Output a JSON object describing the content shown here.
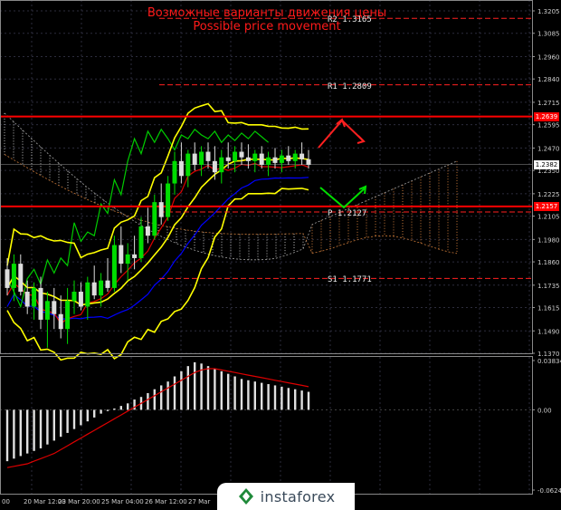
{
  "titles": {
    "ru": "Возможные варианты движения цены",
    "en": "Possible price movement"
  },
  "chart_data": {
    "type": "candlestick",
    "price_axis": {
      "min": 1.137,
      "max": 1.3205,
      "ticks": [
        "1.3205",
        "1.3085",
        "1.2960",
        "1.2840",
        "1.2715",
        "1.2595",
        "1.2470",
        "1.2350",
        "1.2225",
        "1.2105",
        "1.1980",
        "1.1860",
        "1.1735",
        "1.1615",
        "1.1490",
        "1.1370"
      ]
    },
    "oscillator_axis": {
      "min": -0.06247,
      "max": 0.03834,
      "ticks": [
        "0.03834",
        "0.00",
        "-0.06247"
      ]
    },
    "time_axis": [
      "00",
      "20 Mar 12:00",
      "23 Mar 20:00",
      "25 Mar 04:00",
      "26 Mar 12:00",
      "27 Mar"
    ],
    "levels": [
      {
        "name": "R2",
        "label": "R2  1.3165",
        "value": 1.3165,
        "style": "dashed",
        "color": "#ff2020"
      },
      {
        "name": "R1",
        "label": "R1  1.2809",
        "value": 1.2809,
        "style": "dashed",
        "color": "#ff2020"
      },
      {
        "name": "Resistance",
        "label": "1.2639",
        "value": 1.2639,
        "style": "solid",
        "color": "#ff0000"
      },
      {
        "name": "Pivot",
        "label": "P  1.2127",
        "value": 1.2127,
        "style": "dashed",
        "color": "#ff2020"
      },
      {
        "name": "Support",
        "label": "1.2157",
        "value": 1.2157,
        "style": "solid",
        "color": "#ff0000"
      },
      {
        "name": "S1",
        "label": "S1  1.1771",
        "value": 1.1771,
        "style": "dashed",
        "color": "#ff2020"
      }
    ],
    "current_price": "1.2382",
    "candles": [
      [
        1.182,
        1.188,
        1.168,
        1.172
      ],
      [
        1.172,
        1.19,
        1.165,
        1.185
      ],
      [
        1.185,
        1.19,
        1.168,
        1.17
      ],
      [
        1.17,
        1.176,
        1.158,
        1.162
      ],
      [
        1.162,
        1.175,
        1.155,
        1.172
      ],
      [
        1.172,
        1.178,
        1.15,
        1.155
      ],
      [
        1.155,
        1.17,
        1.14,
        1.165
      ],
      [
        1.165,
        1.172,
        1.15,
        1.158
      ],
      [
        1.158,
        1.168,
        1.145,
        1.15
      ],
      [
        1.15,
        1.172,
        1.142,
        1.165
      ],
      [
        1.165,
        1.176,
        1.158,
        1.17
      ],
      [
        1.17,
        1.175,
        1.16,
        1.162
      ],
      [
        1.162,
        1.178,
        1.155,
        1.175
      ],
      [
        1.175,
        1.184,
        1.166,
        1.168
      ],
      [
        1.168,
        1.18,
        1.162,
        1.176
      ],
      [
        1.176,
        1.188,
        1.17,
        1.172
      ],
      [
        1.172,
        1.2,
        1.17,
        1.195
      ],
      [
        1.195,
        1.205,
        1.18,
        1.185
      ],
      [
        1.185,
        1.196,
        1.176,
        1.19
      ],
      [
        1.19,
        1.2,
        1.182,
        1.188
      ],
      [
        1.188,
        1.21,
        1.186,
        1.205
      ],
      [
        1.205,
        1.215,
        1.196,
        1.2
      ],
      [
        1.2,
        1.222,
        1.198,
        1.218
      ],
      [
        1.218,
        1.228,
        1.206,
        1.21
      ],
      [
        1.21,
        1.232,
        1.208,
        1.228
      ],
      [
        1.228,
        1.245,
        1.222,
        1.24
      ],
      [
        1.24,
        1.25,
        1.228,
        1.232
      ],
      [
        1.232,
        1.246,
        1.226,
        1.244
      ],
      [
        1.244,
        1.25,
        1.235,
        1.238
      ],
      [
        1.238,
        1.248,
        1.232,
        1.245
      ],
      [
        1.245,
        1.25,
        1.236,
        1.24
      ],
      [
        1.24,
        1.248,
        1.23,
        1.234
      ],
      [
        1.234,
        1.246,
        1.228,
        1.242
      ],
      [
        1.242,
        1.25,
        1.236,
        1.24
      ],
      [
        1.24,
        1.248,
        1.234,
        1.245
      ],
      [
        1.245,
        1.25,
        1.238,
        1.242
      ],
      [
        1.242,
        1.249,
        1.236,
        1.24
      ],
      [
        1.24,
        1.246,
        1.234,
        1.244
      ],
      [
        1.244,
        1.248,
        1.236,
        1.238
      ],
      [
        1.238,
        1.245,
        1.232,
        1.242
      ],
      [
        1.242,
        1.247,
        1.236,
        1.239
      ],
      [
        1.239,
        1.246,
        1.234,
        1.243
      ],
      [
        1.243,
        1.248,
        1.238,
        1.24
      ],
      [
        1.24,
        1.246,
        1.236,
        1.244
      ],
      [
        1.244,
        1.25,
        1.238,
        1.241
      ],
      [
        1.241,
        1.246,
        1.236,
        1.238
      ]
    ],
    "histogram": [
      -0.04,
      -0.038,
      -0.036,
      -0.034,
      -0.032,
      -0.03,
      -0.027,
      -0.024,
      -0.021,
      -0.018,
      -0.015,
      -0.012,
      -0.009,
      -0.006,
      -0.003,
      -0.001,
      0.001,
      0.003,
      0.005,
      0.008,
      0.01,
      0.013,
      0.016,
      0.019,
      0.022,
      0.026,
      0.03,
      0.034,
      0.037,
      0.036,
      0.034,
      0.032,
      0.03,
      0.028,
      0.026,
      0.024,
      0.023,
      0.022,
      0.021,
      0.02,
      0.019,
      0.018,
      0.017,
      0.016,
      0.015,
      0.014
    ],
    "signal_line": [
      -0.045,
      -0.044,
      -0.043,
      -0.042,
      -0.04,
      -0.038,
      -0.036,
      -0.034,
      -0.031,
      -0.028,
      -0.025,
      -0.022,
      -0.019,
      -0.016,
      -0.013,
      -0.01,
      -0.007,
      -0.004,
      -0.001,
      0.002,
      0.005,
      0.008,
      0.011,
      0.014,
      0.017,
      0.02,
      0.023,
      0.026,
      0.029,
      0.031,
      0.032,
      0.032,
      0.031,
      0.03,
      0.029,
      0.028,
      0.027,
      0.026,
      0.025,
      0.024,
      0.023,
      0.022,
      0.021,
      0.02,
      0.019,
      0.018
    ],
    "colors": {
      "bull": "#00dd00",
      "bear": "#dddddd",
      "bollinger": "#ffff00",
      "level": "#ff0000",
      "tenkan": "#dd0000",
      "kijun": "#0000ff",
      "chikou": "#00cc00",
      "signal": "#dd0000",
      "histogram": "#e0e0e0"
    }
  },
  "logo": {
    "text": "instaforex"
  }
}
